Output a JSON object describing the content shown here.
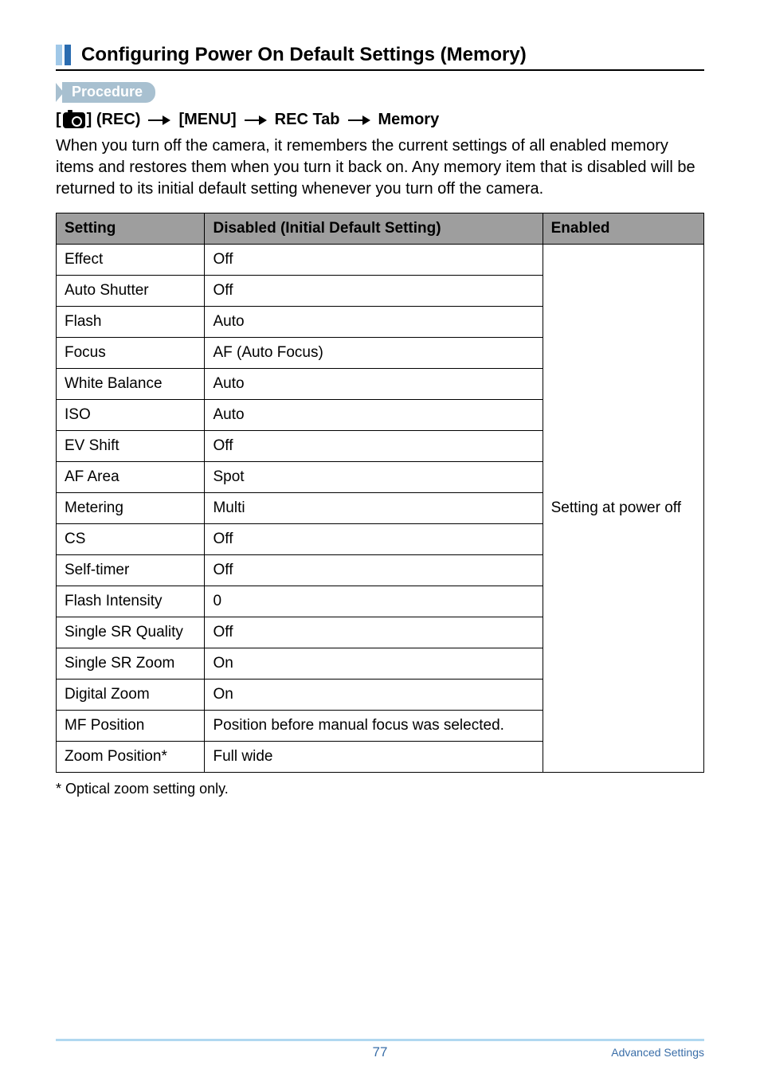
{
  "section": {
    "title": "Configuring Power On Default Settings (Memory)"
  },
  "procedure_label": "Procedure",
  "breadcrumb": {
    "part1_prefix": "[",
    "part1_suffix": "] (REC)",
    "part2": "[MENU]",
    "part3": "REC Tab",
    "part4": "Memory"
  },
  "description": "When you turn off the camera, it remembers the current settings of all enabled memory items and restores them when you turn it back on. Any memory item that is disabled will be returned to its initial default setting whenever you turn off the camera.",
  "table": {
    "headers": {
      "setting": "Setting",
      "disabled": "Disabled (Initial Default Setting)",
      "enabled": "Enabled"
    },
    "enabled_value": "Setting at power off",
    "rows": [
      {
        "setting": "Effect",
        "disabled": "Off"
      },
      {
        "setting": "Auto Shutter",
        "disabled": "Off"
      },
      {
        "setting": "Flash",
        "disabled": "Auto"
      },
      {
        "setting": "Focus",
        "disabled": "AF (Auto Focus)"
      },
      {
        "setting": "White Balance",
        "disabled": "Auto"
      },
      {
        "setting": "ISO",
        "disabled": "Auto"
      },
      {
        "setting": "EV Shift",
        "disabled": "Off"
      },
      {
        "setting": "AF Area",
        "disabled": "Spot"
      },
      {
        "setting": "Metering",
        "disabled": "Multi"
      },
      {
        "setting": "CS",
        "disabled": "Off"
      },
      {
        "setting": "Self-timer",
        "disabled": "Off"
      },
      {
        "setting": "Flash Intensity",
        "disabled": "0"
      },
      {
        "setting": "Single SR Quality",
        "disabled": "Off"
      },
      {
        "setting": "Single SR Zoom",
        "disabled": "On"
      },
      {
        "setting": "Digital Zoom",
        "disabled": "On"
      },
      {
        "setting": "MF Position",
        "disabled": "Position before manual focus was selected."
      },
      {
        "setting": "Zoom Position*",
        "disabled": "Full wide"
      }
    ]
  },
  "footnote": "* Optical zoom setting only.",
  "footer": {
    "page": "77",
    "section": "Advanced Settings"
  }
}
